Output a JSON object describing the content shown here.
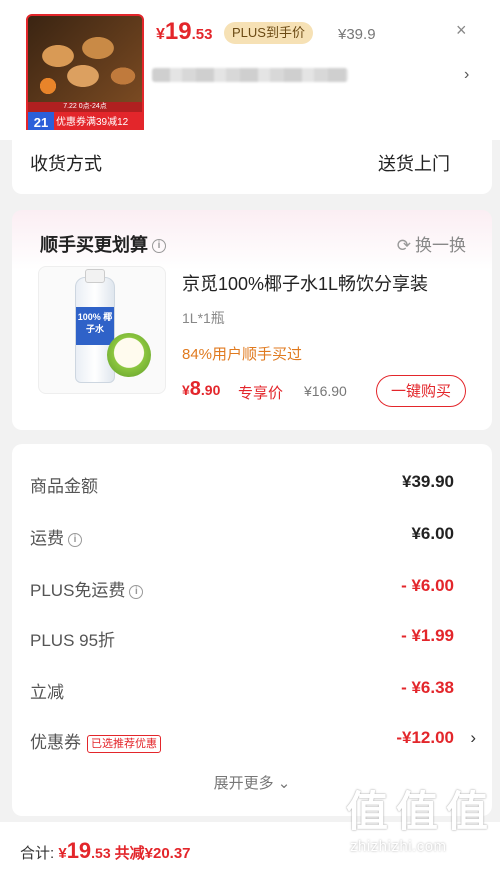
{
  "header": {
    "thumb_date": "7.22 0点-24点",
    "thumb_price": "21",
    "thumb_coupon": "优惠券满39减12",
    "price_symbol": "¥",
    "price_int": "19",
    "price_dec": ".53",
    "plus_badge": "PLUS到手价",
    "orig_price": "¥39.9",
    "close": "×",
    "arrow": "›"
  },
  "delivery": {
    "label": "收货方式",
    "value": "送货上门"
  },
  "addon": {
    "title": "顺手买更划算",
    "info_icon": "i",
    "swap_label": "换一换",
    "swap_icon": "⟳",
    "product": {
      "name": "京觅100%椰子水1L畅饮分享装",
      "spec": "1L*1瓶",
      "stat": "84%用户顺手买过",
      "price_symbol": "¥",
      "price_int": "8",
      "price_dec": ".90",
      "price_tag": "专享价",
      "orig_price": "¥16.90",
      "buy_label": "一键购买",
      "bottle_label": "100% 椰子水"
    }
  },
  "summary": {
    "rows": [
      {
        "label": "商品金额",
        "value": "¥39.90"
      },
      {
        "label": "运费",
        "value": "¥6.00"
      },
      {
        "label": "PLUS免运费",
        "value": "- ¥6.00"
      },
      {
        "label": "PLUS 95折",
        "value": "- ¥1.99"
      },
      {
        "label": "立减",
        "value": "- ¥6.38"
      },
      {
        "label": "优惠券",
        "value": "-¥12.00",
        "tag": "已选推荐优惠"
      }
    ],
    "expand": "展开更多 ⌄",
    "arrow": "›"
  },
  "bottom": {
    "label": "合计:",
    "amount_symbol": "¥",
    "amount_int": "19",
    "amount_dec": ".53",
    "saved": "共减¥20.37"
  },
  "watermark": {
    "glyph": "值",
    "text": "zhizhizhi.com"
  },
  "colors": {
    "accent": "#e3262b",
    "plus_gold": "#f6e1b5",
    "stat_orange": "#e07a1f"
  }
}
